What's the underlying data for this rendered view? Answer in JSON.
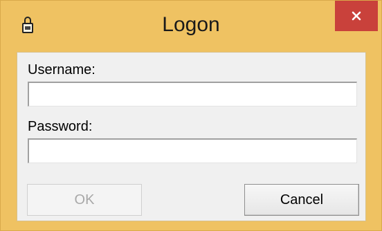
{
  "window": {
    "title": "Logon",
    "close_glyph": "✕",
    "icons": {
      "app": "lock-icon",
      "close": "close-icon"
    },
    "colors": {
      "frame": "#efc262",
      "close_button": "#c9413b",
      "client": "#f0f0f0"
    }
  },
  "form": {
    "username": {
      "label": "Username:",
      "value": "",
      "placeholder": ""
    },
    "password": {
      "label": "Password:",
      "value": "",
      "placeholder": ""
    }
  },
  "buttons": {
    "ok_label": "OK",
    "ok_enabled": false,
    "cancel_label": "Cancel"
  }
}
